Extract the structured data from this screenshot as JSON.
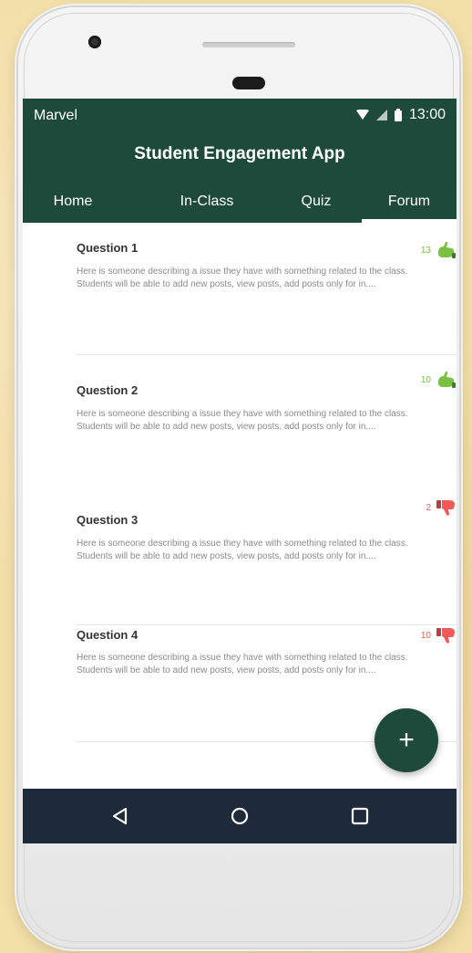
{
  "status_bar": {
    "carrier": "Marvel",
    "time": "13:00"
  },
  "app": {
    "title": "Student Engagement App"
  },
  "tabs": [
    {
      "label": "Home",
      "active": false
    },
    {
      "label": "In-Class",
      "active": false
    },
    {
      "label": "Quiz",
      "active": false
    },
    {
      "label": "Forum",
      "active": true
    }
  ],
  "posts": [
    {
      "title": "Question 1",
      "body": "Here is someone describing a issue they have with something related to the class. Students will be able to add new posts, view posts, add posts only for in....",
      "votes": "13",
      "vote_type": "up"
    },
    {
      "title": "Question 2",
      "body": "Here is someone describing a issue they have with something related to the class. Students will be able to add new posts, view posts, add posts only for in....",
      "votes": "10",
      "vote_type": "up"
    },
    {
      "title": "Question 3",
      "body": "Here is someone describing a issue they have with something related to the class. Students will be able to add new posts, view posts, add posts only for in....",
      "votes": "2",
      "vote_type": "down"
    },
    {
      "title": "Question 4",
      "body": "Here is someone describing a issue they have with something related to the class. Students will be able to add new posts, view posts, add posts only for in....",
      "votes": "10",
      "vote_type": "down"
    }
  ],
  "fab": {
    "label": "+"
  },
  "colors": {
    "header": "#1e4a3b",
    "upvote": "#7ac142",
    "downvote": "#f25a5a",
    "navbar": "#1e2a39"
  },
  "icons": {
    "back": "back-triangle-icon",
    "home": "home-circle-icon",
    "recents": "recents-square-icon"
  }
}
